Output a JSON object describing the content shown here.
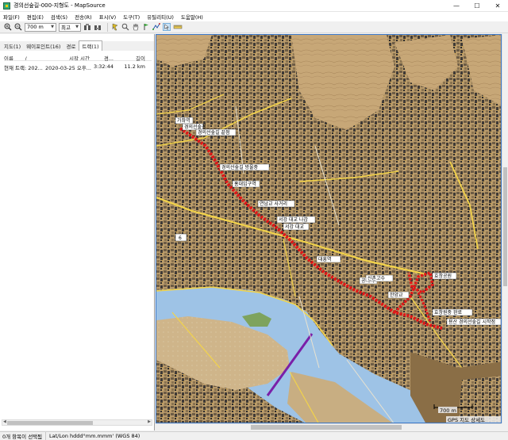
{
  "window": {
    "title": "경의선숲길-000-지형도 - MapSource",
    "minimize": "—",
    "maximize": "☐",
    "close": "✕"
  },
  "menu": [
    "파일(F)",
    "편집(E)",
    "검색(S)",
    "전송(R)",
    "표시(V)",
    "도구(T)",
    "유틸리티(U)",
    "도움말(H)"
  ],
  "toolbar": {
    "zoom_in_icon": "zoom-in-icon",
    "zoom_out_icon": "zoom-out-icon",
    "scale_value": "700 m",
    "detail_value": "최고",
    "tools": [
      "selection-tool-icon",
      "zoom-tool-icon",
      "hand-tool-icon",
      "waypoint-tool-icon",
      "route-tool-icon",
      "pointer-tool-icon",
      "measure-tool-icon"
    ]
  },
  "left_panel": {
    "tabs": [
      "지도(1)",
      "웨이포인트(16)",
      "경로",
      "트랙(1)"
    ],
    "active_tab": "트랙(1)",
    "columns": [
      "이름",
      "/",
      "시작 시간",
      "경...",
      "길이"
    ],
    "rows": [
      {
        "name": "현재 트랙: 202...",
        "start": "2020-03-25 오후...",
        "duration": "3:32:44",
        "length": "11.2 km"
      }
    ]
  },
  "map": {
    "waypoints": [
      "가좌역",
      "경의선숲길",
      "경의선숲길 끝점",
      "경의선숲길 방울중",
      "홍대입구역",
      "연남교 사거리",
      "서강 대교 나감",
      "서강 대교",
      "대흥역",
      "공덕역",
      "신촌고수",
      "한양교",
      "효창공원",
      "효창원중 완료",
      "용산 경의선숲길 시작점"
    ],
    "road_sign": "6",
    "scale_label": "700 m",
    "attribution": "GPS 지도 상세도",
    "track_color": "#e01818",
    "water_color": "#9ec3e6",
    "subway_line_color": "#7a1fa8"
  },
  "status": {
    "selection": "0개 항목이 선택됨",
    "coords": "Lat/Lon hddd°mm.mmm' (WGS 84)"
  }
}
